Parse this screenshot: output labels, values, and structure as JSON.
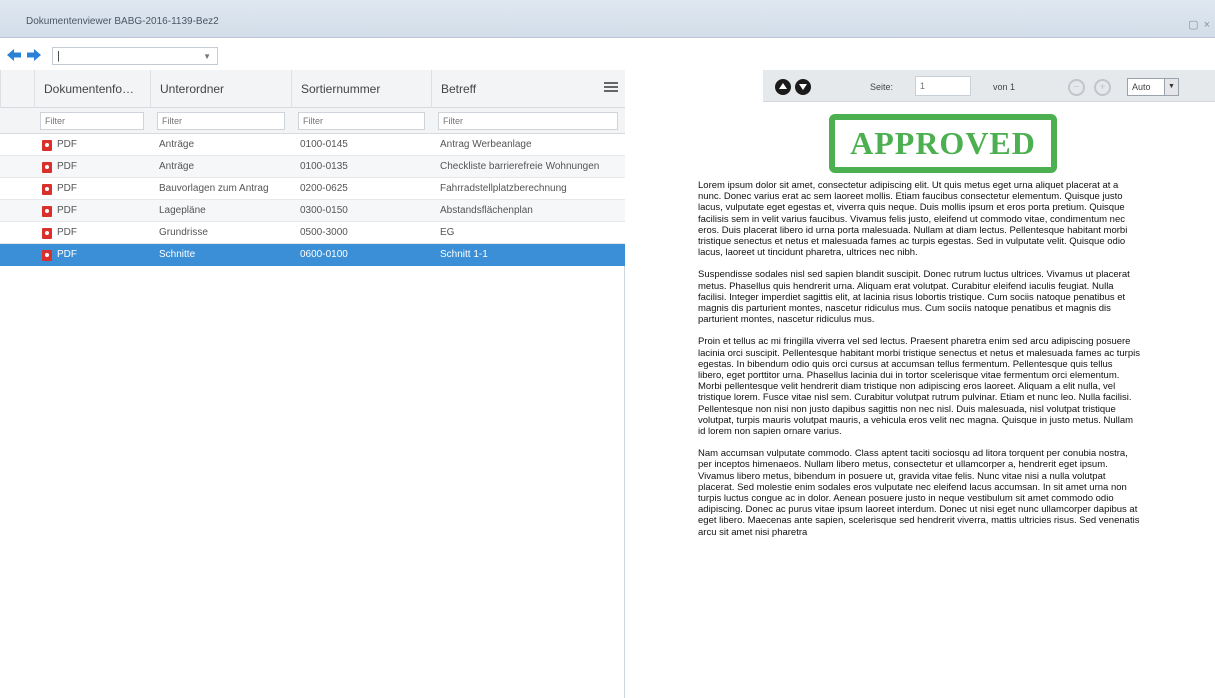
{
  "window": {
    "title": "Dokumentenviewer BABG-2016-1139-Bez2",
    "controls": "▢ ×"
  },
  "nav": {
    "combo_value": "|",
    "combo_caret": "▼"
  },
  "grid": {
    "columns": [
      "Dokumentenfo…",
      "Unterordner",
      "Sortiernummer",
      "Betreff"
    ],
    "filter_placeholder": "Filter",
    "rows": [
      {
        "type": "PDF",
        "unterordner": "Anträge",
        "sortiernummer": "0100-0145",
        "betreff": "Antrag Werbeanlage",
        "selected": false
      },
      {
        "type": "PDF",
        "unterordner": "Anträge",
        "sortiernummer": "0100-0135",
        "betreff": "Checkliste barrierefreie Wohnungen",
        "selected": false
      },
      {
        "type": "PDF",
        "unterordner": "Bauvorlagen zum Antrag",
        "sortiernummer": "0200-0625",
        "betreff": "Fahrradstellplatzberechnung",
        "selected": false
      },
      {
        "type": "PDF",
        "unterordner": "Lagepläne",
        "sortiernummer": "0300-0150",
        "betreff": "Abstandsflächenplan",
        "selected": false
      },
      {
        "type": "PDF",
        "unterordner": "Grundrisse",
        "sortiernummer": "0500-3000",
        "betreff": "EG",
        "selected": false
      },
      {
        "type": "PDF",
        "unterordner": "Schnitte",
        "sortiernummer": "0600-0100",
        "betreff": "Schnitt 1-1",
        "selected": true
      }
    ]
  },
  "viewer": {
    "seite_label": "Seite:",
    "page_placeholder": "1",
    "von_label": "von 1",
    "zoom_value": "Auto",
    "zoom_arrow": "▼",
    "zoom_out_symbol": "−",
    "zoom_in_symbol": "+",
    "stamp": "APPROVED",
    "paragraphs": [
      "Lorem ipsum dolor sit amet, consectetur adipiscing elit. Ut quis metus eget urna aliquet placerat at a nunc. Donec varius erat ac sem laoreet mollis. Etiam faucibus consectetur elementum. Quisque justo lacus, vulputate eget egestas et, viverra quis neque. Duis mollis ipsum et eros porta pretium. Quisque facilisis sem in velit varius faucibus. Vivamus felis justo, eleifend ut commodo vitae, condimentum nec eros. Duis placerat libero id urna porta malesuada. Nullam at diam lectus. Pellentesque habitant morbi tristique senectus et netus et malesuada fames ac turpis egestas. Sed in vulputate velit. Quisque odio lacus, laoreet ut tincidunt pharetra, ultrices nec nibh.",
      "Suspendisse sodales nisl sed sapien blandit suscipit. Donec rutrum luctus ultrices. Vivamus ut placerat metus. Phasellus quis hendrerit urna. Aliquam erat volutpat. Curabitur eleifend iaculis feugiat. Nulla facilisi. Integer imperdiet sagittis elit, at lacinia risus lobortis tristique. Cum sociis natoque penatibus et magnis dis parturient montes, nascetur ridiculus mus. Cum sociis natoque penatibus et magnis dis parturient montes, nascetur ridiculus mus.",
      "Proin et tellus ac mi fringilla viverra vel sed lectus. Praesent pharetra enim sed arcu adipiscing posuere lacinia orci suscipit. Pellentesque habitant morbi tristique senectus et netus et malesuada fames ac turpis egestas. In bibendum odio quis orci cursus at accumsan tellus fermentum. Pellentesque quis tellus libero, eget porttitor urna. Phasellus lacinia dui in tortor scelerisque vitae fermentum orci elementum. Morbi pellentesque velit hendrerit diam tristique non adipiscing eros laoreet. Aliquam a elit nulla, vel tristique lorem. Fusce vitae nisl sem. Curabitur volutpat rutrum pulvinar. Etiam et nunc leo. Nulla facilisi. Pellentesque non nisi non justo dapibus sagittis non nec nisl. Duis malesuada, nisl volutpat tristique volutpat, turpis mauris volutpat mauris, a vehicula eros velit nec magna. Quisque in justo metus. Nullam id lorem non sapien ornare varius.",
      "Nam accumsan vulputate commodo. Class aptent taciti sociosqu ad litora torquent per conubia nostra, per inceptos himenaeos. Nullam libero metus, consectetur et ullamcorper a, hendrerit eget ipsum. Vivamus libero metus, bibendum in posuere ut, gravida vitae felis. Nunc vitae nisi a nulla volutpat placerat. Sed molestie enim sodales eros vulputate nec eleifend lacus accumsan. In sit amet urna non turpis luctus congue ac in dolor. Aenean posuere justo in neque vestibulum sit amet commodo odio adipiscing. Donec ac purus vitae ipsum laoreet interdum. Donec ut nisi eget nunc ullamcorper dapibus at eget libero. Maecenas ante sapien, scelerisque sed hendrerit viverra, mattis ultricies risus. Sed venenatis arcu sit amet nisi pharetra"
    ]
  }
}
